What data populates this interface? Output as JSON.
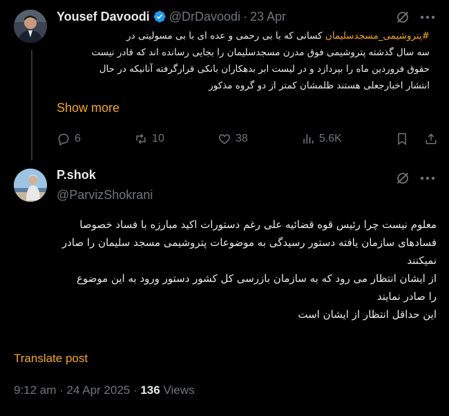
{
  "parent_tweet": {
    "author_name": "Yousef Davoodi",
    "handle": "@DrDavoodi",
    "separator": "·",
    "date": "23 Apr",
    "hashtag": "#پتروشیمی_مسجدسلیمان",
    "lines": [
      "کسانی که با بی رحمی و عده ای با بی مسولیتی در",
      "سه سال گذشته پتروشیمی فوق مدرن مسجدسلیمان را بجایی رسانده اند که قادر نیست",
      "حقوق فروردین ماه را بپردازد و در لیست ابر بدهکاران بانکی قرارگرفته آنانیکه در حال",
      "انتشار اخبارجعلی هستند ظلمشان کمتر از  دو گروه مذکور"
    ],
    "show_more": "Show more",
    "counts": {
      "replies": "6",
      "reposts": "10",
      "likes": "38",
      "views": "5.6K"
    }
  },
  "main_tweet": {
    "author_name": "P.shok",
    "handle": "@ParvizShokrani",
    "lines": [
      "معلوم نیست چرا رئیس قوه قضائیه علی رغم دستورات اکید مبارزه با فساد خصوصا",
      "فسادهای سازمان یافته دستور رسیدگی به موضوعات پتروشیمی مسجد  سلیمان را صادر",
      "نمیکنند",
      "از ایشان انتظار می رود که به سازمان بازرسی کل کشور دستور ورود به این موضوع",
      "را صادر نمایند",
      "این حداقل انتظار از ایشان است"
    ],
    "translate_label": "Translate post",
    "timestamp": "9:12 am · 24 Apr 2025 · ",
    "views_count": "136",
    "views_label": " Views"
  },
  "icons": {
    "verified": "verified-badge-icon",
    "grok": "grok-icon",
    "more": "more-icon",
    "reply": "reply-icon",
    "repost": "repost-icon",
    "like": "like-icon",
    "views": "views-icon",
    "bookmark": "bookmark-icon",
    "share": "share-icon"
  },
  "colors": {
    "background": "#000000",
    "text": "#e7e9ea",
    "muted": "#71767b",
    "accent": "#f5a623",
    "verified": "#1d9bf0"
  }
}
